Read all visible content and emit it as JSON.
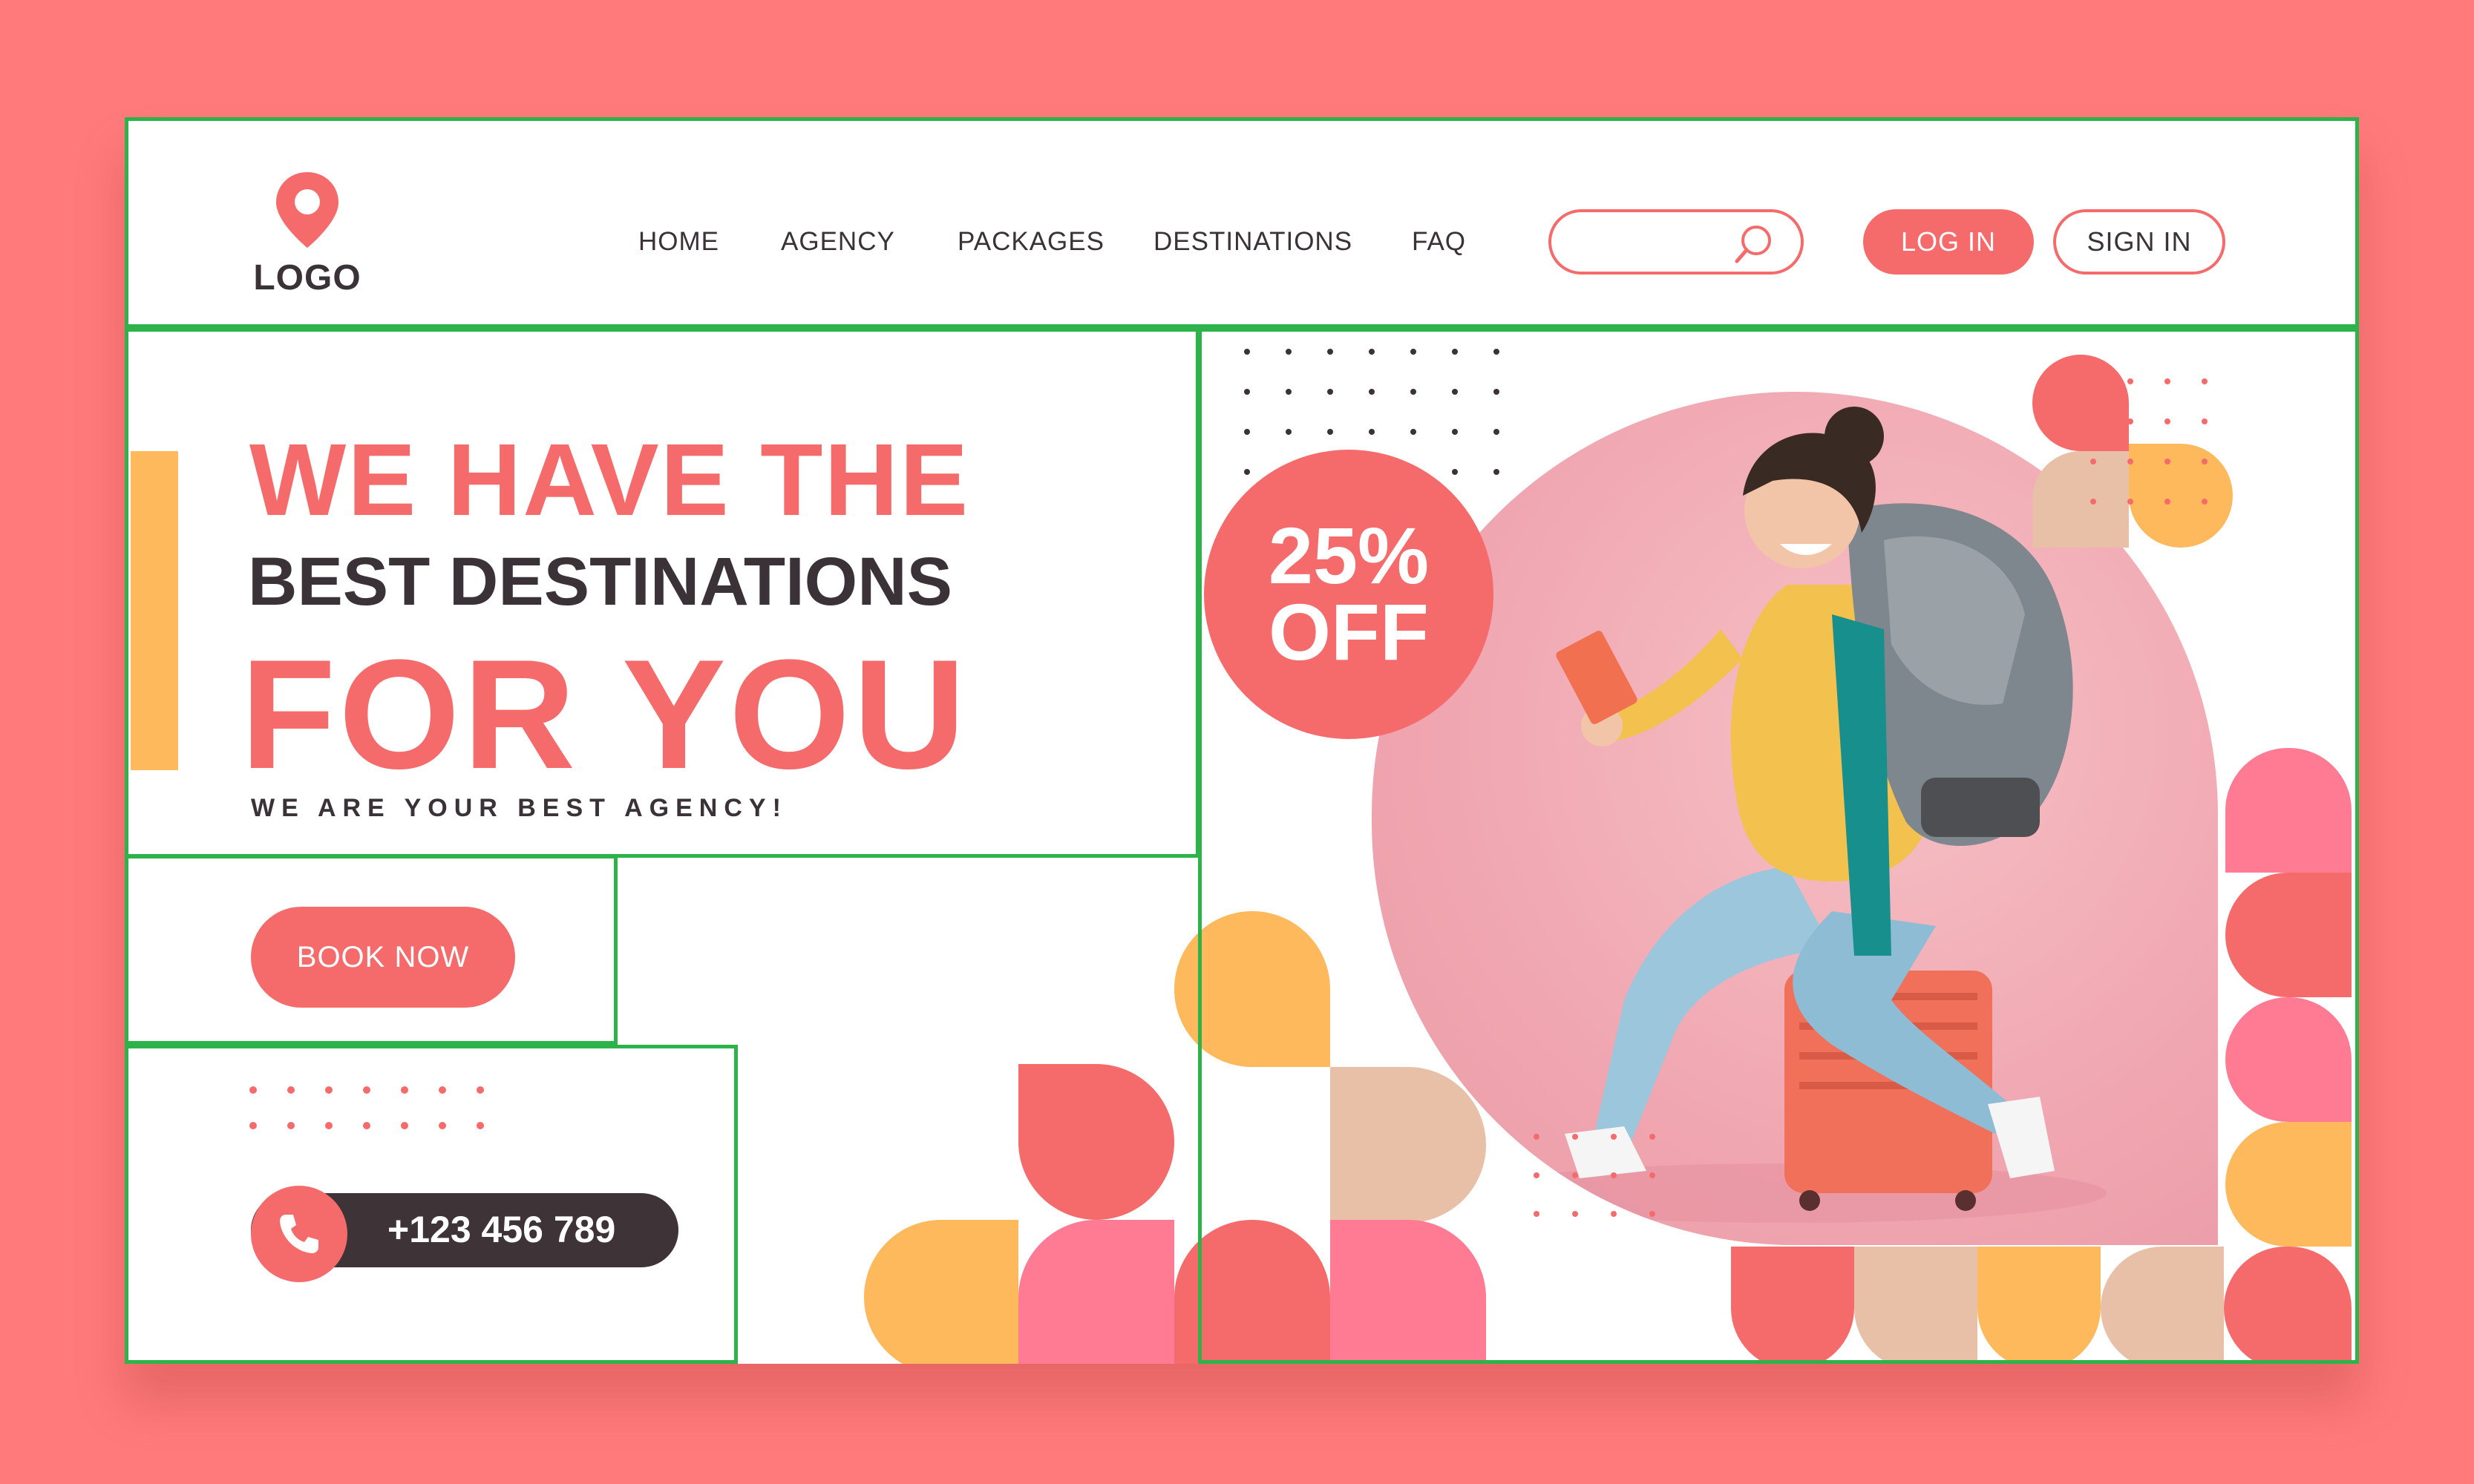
{
  "logo": {
    "text": "LOGO"
  },
  "nav": {
    "items": [
      {
        "label": "HOME"
      },
      {
        "label": "AGENCY"
      },
      {
        "label": "PACKAGES"
      },
      {
        "label": "DESTINATIONS"
      },
      {
        "label": "FAQ"
      }
    ]
  },
  "search": {
    "placeholder": ""
  },
  "auth": {
    "login_label": "LOG IN",
    "signin_label": "SIGN IN"
  },
  "hero": {
    "line1": "WE HAVE THE",
    "line2": "BEST DESTINATIONS",
    "line3": "FOR YOU",
    "tagline": "WE ARE YOUR BEST AGENCY!",
    "cta_label": "BOOK NOW"
  },
  "contact": {
    "phone": "+123 456 789"
  },
  "promo": {
    "percent": "25%",
    "off": "OFF"
  },
  "colors": {
    "background": "#ff7b7b",
    "primary": "#f56b6b",
    "dark": "#3a3236",
    "yellow": "#fdb95c",
    "pink": "#ff7b93",
    "beige": "#e8c0a8"
  }
}
